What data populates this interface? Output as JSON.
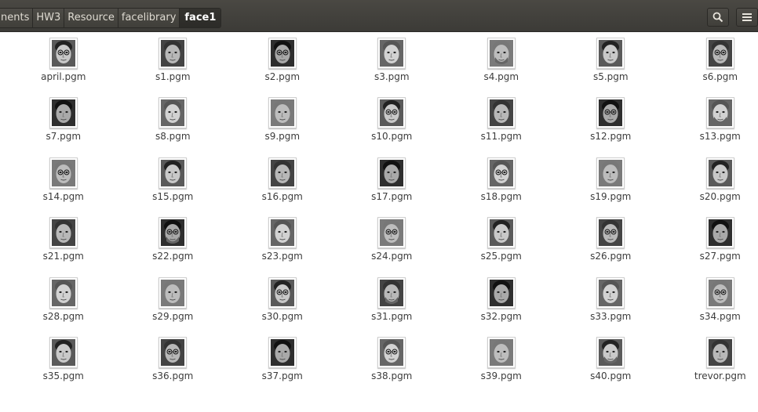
{
  "breadcrumbs": [
    {
      "label": "nents",
      "active": false
    },
    {
      "label": "HW3",
      "active": false
    },
    {
      "label": "Resource",
      "active": false
    },
    {
      "label": "facelibrary",
      "active": false
    },
    {
      "label": "face1",
      "active": true
    }
  ],
  "toolbar": {
    "search_icon": "search-icon",
    "menu_icon": "hamburger-menu-icon"
  },
  "files": [
    "april.pgm",
    "s1.pgm",
    "s2.pgm",
    "s3.pgm",
    "s4.pgm",
    "s5.pgm",
    "s6.pgm",
    "s7.pgm",
    "s8.pgm",
    "s9.pgm",
    "s10.pgm",
    "s11.pgm",
    "s12.pgm",
    "s13.pgm",
    "s14.pgm",
    "s15.pgm",
    "s16.pgm",
    "s17.pgm",
    "s18.pgm",
    "s19.pgm",
    "s20.pgm",
    "s21.pgm",
    "s22.pgm",
    "s23.pgm",
    "s24.pgm",
    "s25.pgm",
    "s26.pgm",
    "s27.pgm",
    "s28.pgm",
    "s29.pgm",
    "s30.pgm",
    "s31.pgm",
    "s32.pgm",
    "s33.pgm",
    "s34.pgm",
    "s35.pgm",
    "s36.pgm",
    "s37.pgm",
    "s38.pgm",
    "s39.pgm",
    "s40.pgm",
    "trevor.pgm"
  ]
}
